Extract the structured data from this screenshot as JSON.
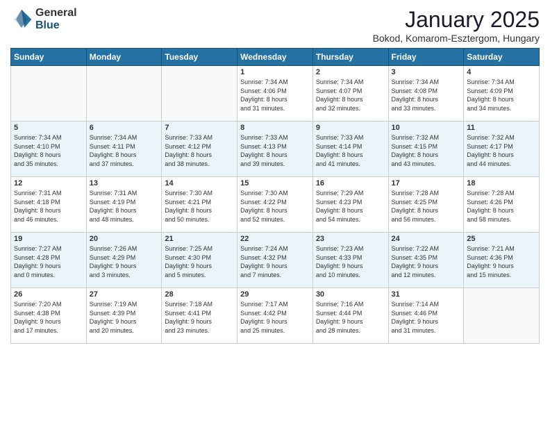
{
  "header": {
    "logo_general": "General",
    "logo_blue": "Blue",
    "month_title": "January 2025",
    "location": "Bokod, Komarom-Esztergom, Hungary"
  },
  "days_of_week": [
    "Sunday",
    "Monday",
    "Tuesday",
    "Wednesday",
    "Thursday",
    "Friday",
    "Saturday"
  ],
  "weeks": [
    {
      "days": [
        {
          "num": "",
          "info": ""
        },
        {
          "num": "",
          "info": ""
        },
        {
          "num": "",
          "info": ""
        },
        {
          "num": "1",
          "info": "Sunrise: 7:34 AM\nSunset: 4:06 PM\nDaylight: 8 hours\nand 31 minutes."
        },
        {
          "num": "2",
          "info": "Sunrise: 7:34 AM\nSunset: 4:07 PM\nDaylight: 8 hours\nand 32 minutes."
        },
        {
          "num": "3",
          "info": "Sunrise: 7:34 AM\nSunset: 4:08 PM\nDaylight: 8 hours\nand 33 minutes."
        },
        {
          "num": "4",
          "info": "Sunrise: 7:34 AM\nSunset: 4:09 PM\nDaylight: 8 hours\nand 34 minutes."
        }
      ]
    },
    {
      "days": [
        {
          "num": "5",
          "info": "Sunrise: 7:34 AM\nSunset: 4:10 PM\nDaylight: 8 hours\nand 35 minutes."
        },
        {
          "num": "6",
          "info": "Sunrise: 7:34 AM\nSunset: 4:11 PM\nDaylight: 8 hours\nand 37 minutes."
        },
        {
          "num": "7",
          "info": "Sunrise: 7:33 AM\nSunset: 4:12 PM\nDaylight: 8 hours\nand 38 minutes."
        },
        {
          "num": "8",
          "info": "Sunrise: 7:33 AM\nSunset: 4:13 PM\nDaylight: 8 hours\nand 39 minutes."
        },
        {
          "num": "9",
          "info": "Sunrise: 7:33 AM\nSunset: 4:14 PM\nDaylight: 8 hours\nand 41 minutes."
        },
        {
          "num": "10",
          "info": "Sunrise: 7:32 AM\nSunset: 4:15 PM\nDaylight: 8 hours\nand 43 minutes."
        },
        {
          "num": "11",
          "info": "Sunrise: 7:32 AM\nSunset: 4:17 PM\nDaylight: 8 hours\nand 44 minutes."
        }
      ]
    },
    {
      "days": [
        {
          "num": "12",
          "info": "Sunrise: 7:31 AM\nSunset: 4:18 PM\nDaylight: 8 hours\nand 46 minutes."
        },
        {
          "num": "13",
          "info": "Sunrise: 7:31 AM\nSunset: 4:19 PM\nDaylight: 8 hours\nand 48 minutes."
        },
        {
          "num": "14",
          "info": "Sunrise: 7:30 AM\nSunset: 4:21 PM\nDaylight: 8 hours\nand 50 minutes."
        },
        {
          "num": "15",
          "info": "Sunrise: 7:30 AM\nSunset: 4:22 PM\nDaylight: 8 hours\nand 52 minutes."
        },
        {
          "num": "16",
          "info": "Sunrise: 7:29 AM\nSunset: 4:23 PM\nDaylight: 8 hours\nand 54 minutes."
        },
        {
          "num": "17",
          "info": "Sunrise: 7:28 AM\nSunset: 4:25 PM\nDaylight: 8 hours\nand 56 minutes."
        },
        {
          "num": "18",
          "info": "Sunrise: 7:28 AM\nSunset: 4:26 PM\nDaylight: 8 hours\nand 58 minutes."
        }
      ]
    },
    {
      "days": [
        {
          "num": "19",
          "info": "Sunrise: 7:27 AM\nSunset: 4:28 PM\nDaylight: 9 hours\nand 0 minutes."
        },
        {
          "num": "20",
          "info": "Sunrise: 7:26 AM\nSunset: 4:29 PM\nDaylight: 9 hours\nand 3 minutes."
        },
        {
          "num": "21",
          "info": "Sunrise: 7:25 AM\nSunset: 4:30 PM\nDaylight: 9 hours\nand 5 minutes."
        },
        {
          "num": "22",
          "info": "Sunrise: 7:24 AM\nSunset: 4:32 PM\nDaylight: 9 hours\nand 7 minutes."
        },
        {
          "num": "23",
          "info": "Sunrise: 7:23 AM\nSunset: 4:33 PM\nDaylight: 9 hours\nand 10 minutes."
        },
        {
          "num": "24",
          "info": "Sunrise: 7:22 AM\nSunset: 4:35 PM\nDaylight: 9 hours\nand 12 minutes."
        },
        {
          "num": "25",
          "info": "Sunrise: 7:21 AM\nSunset: 4:36 PM\nDaylight: 9 hours\nand 15 minutes."
        }
      ]
    },
    {
      "days": [
        {
          "num": "26",
          "info": "Sunrise: 7:20 AM\nSunset: 4:38 PM\nDaylight: 9 hours\nand 17 minutes."
        },
        {
          "num": "27",
          "info": "Sunrise: 7:19 AM\nSunset: 4:39 PM\nDaylight: 9 hours\nand 20 minutes."
        },
        {
          "num": "28",
          "info": "Sunrise: 7:18 AM\nSunset: 4:41 PM\nDaylight: 9 hours\nand 23 minutes."
        },
        {
          "num": "29",
          "info": "Sunrise: 7:17 AM\nSunset: 4:42 PM\nDaylight: 9 hours\nand 25 minutes."
        },
        {
          "num": "30",
          "info": "Sunrise: 7:16 AM\nSunset: 4:44 PM\nDaylight: 9 hours\nand 28 minutes."
        },
        {
          "num": "31",
          "info": "Sunrise: 7:14 AM\nSunset: 4:46 PM\nDaylight: 9 hours\nand 31 minutes."
        },
        {
          "num": "",
          "info": ""
        }
      ]
    }
  ]
}
